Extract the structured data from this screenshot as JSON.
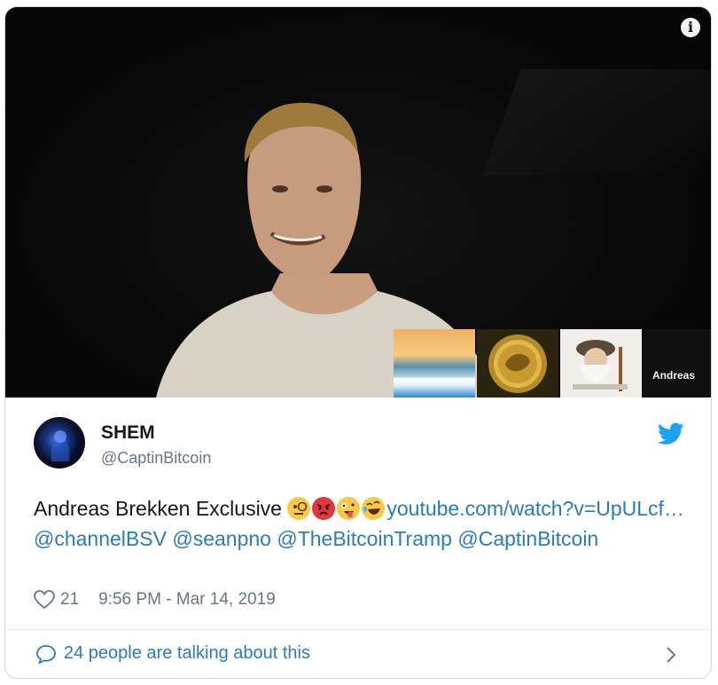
{
  "media": {
    "info_icon": "info-icon",
    "thumbnail_label": "Andreas"
  },
  "tweet": {
    "display_name": "SHEM",
    "handle": "@CaptinBitcoin",
    "text_intro": "Andreas Brekken Exclusive ",
    "emojis": [
      "face-with-monocle",
      "pouting-face",
      "zany-face",
      "rolling-on-floor-laughing"
    ],
    "link_url": "youtube.com/watch?v=UpULcf…",
    "mention_1": "@channelBSV",
    "mention_2": "@seanpno",
    "mention_3": "@TheBitcoinTramp",
    "mention_4": "@CaptinBitcoin",
    "likes": "21",
    "timestamp": "9:56 PM - Mar 14, 2019"
  },
  "footer": {
    "talking_text": "24 people are talking about this"
  },
  "colors": {
    "link": "#2b7bb9",
    "muted": "#657786",
    "text": "#14171a",
    "twitter_blue": "#1da1f2"
  }
}
